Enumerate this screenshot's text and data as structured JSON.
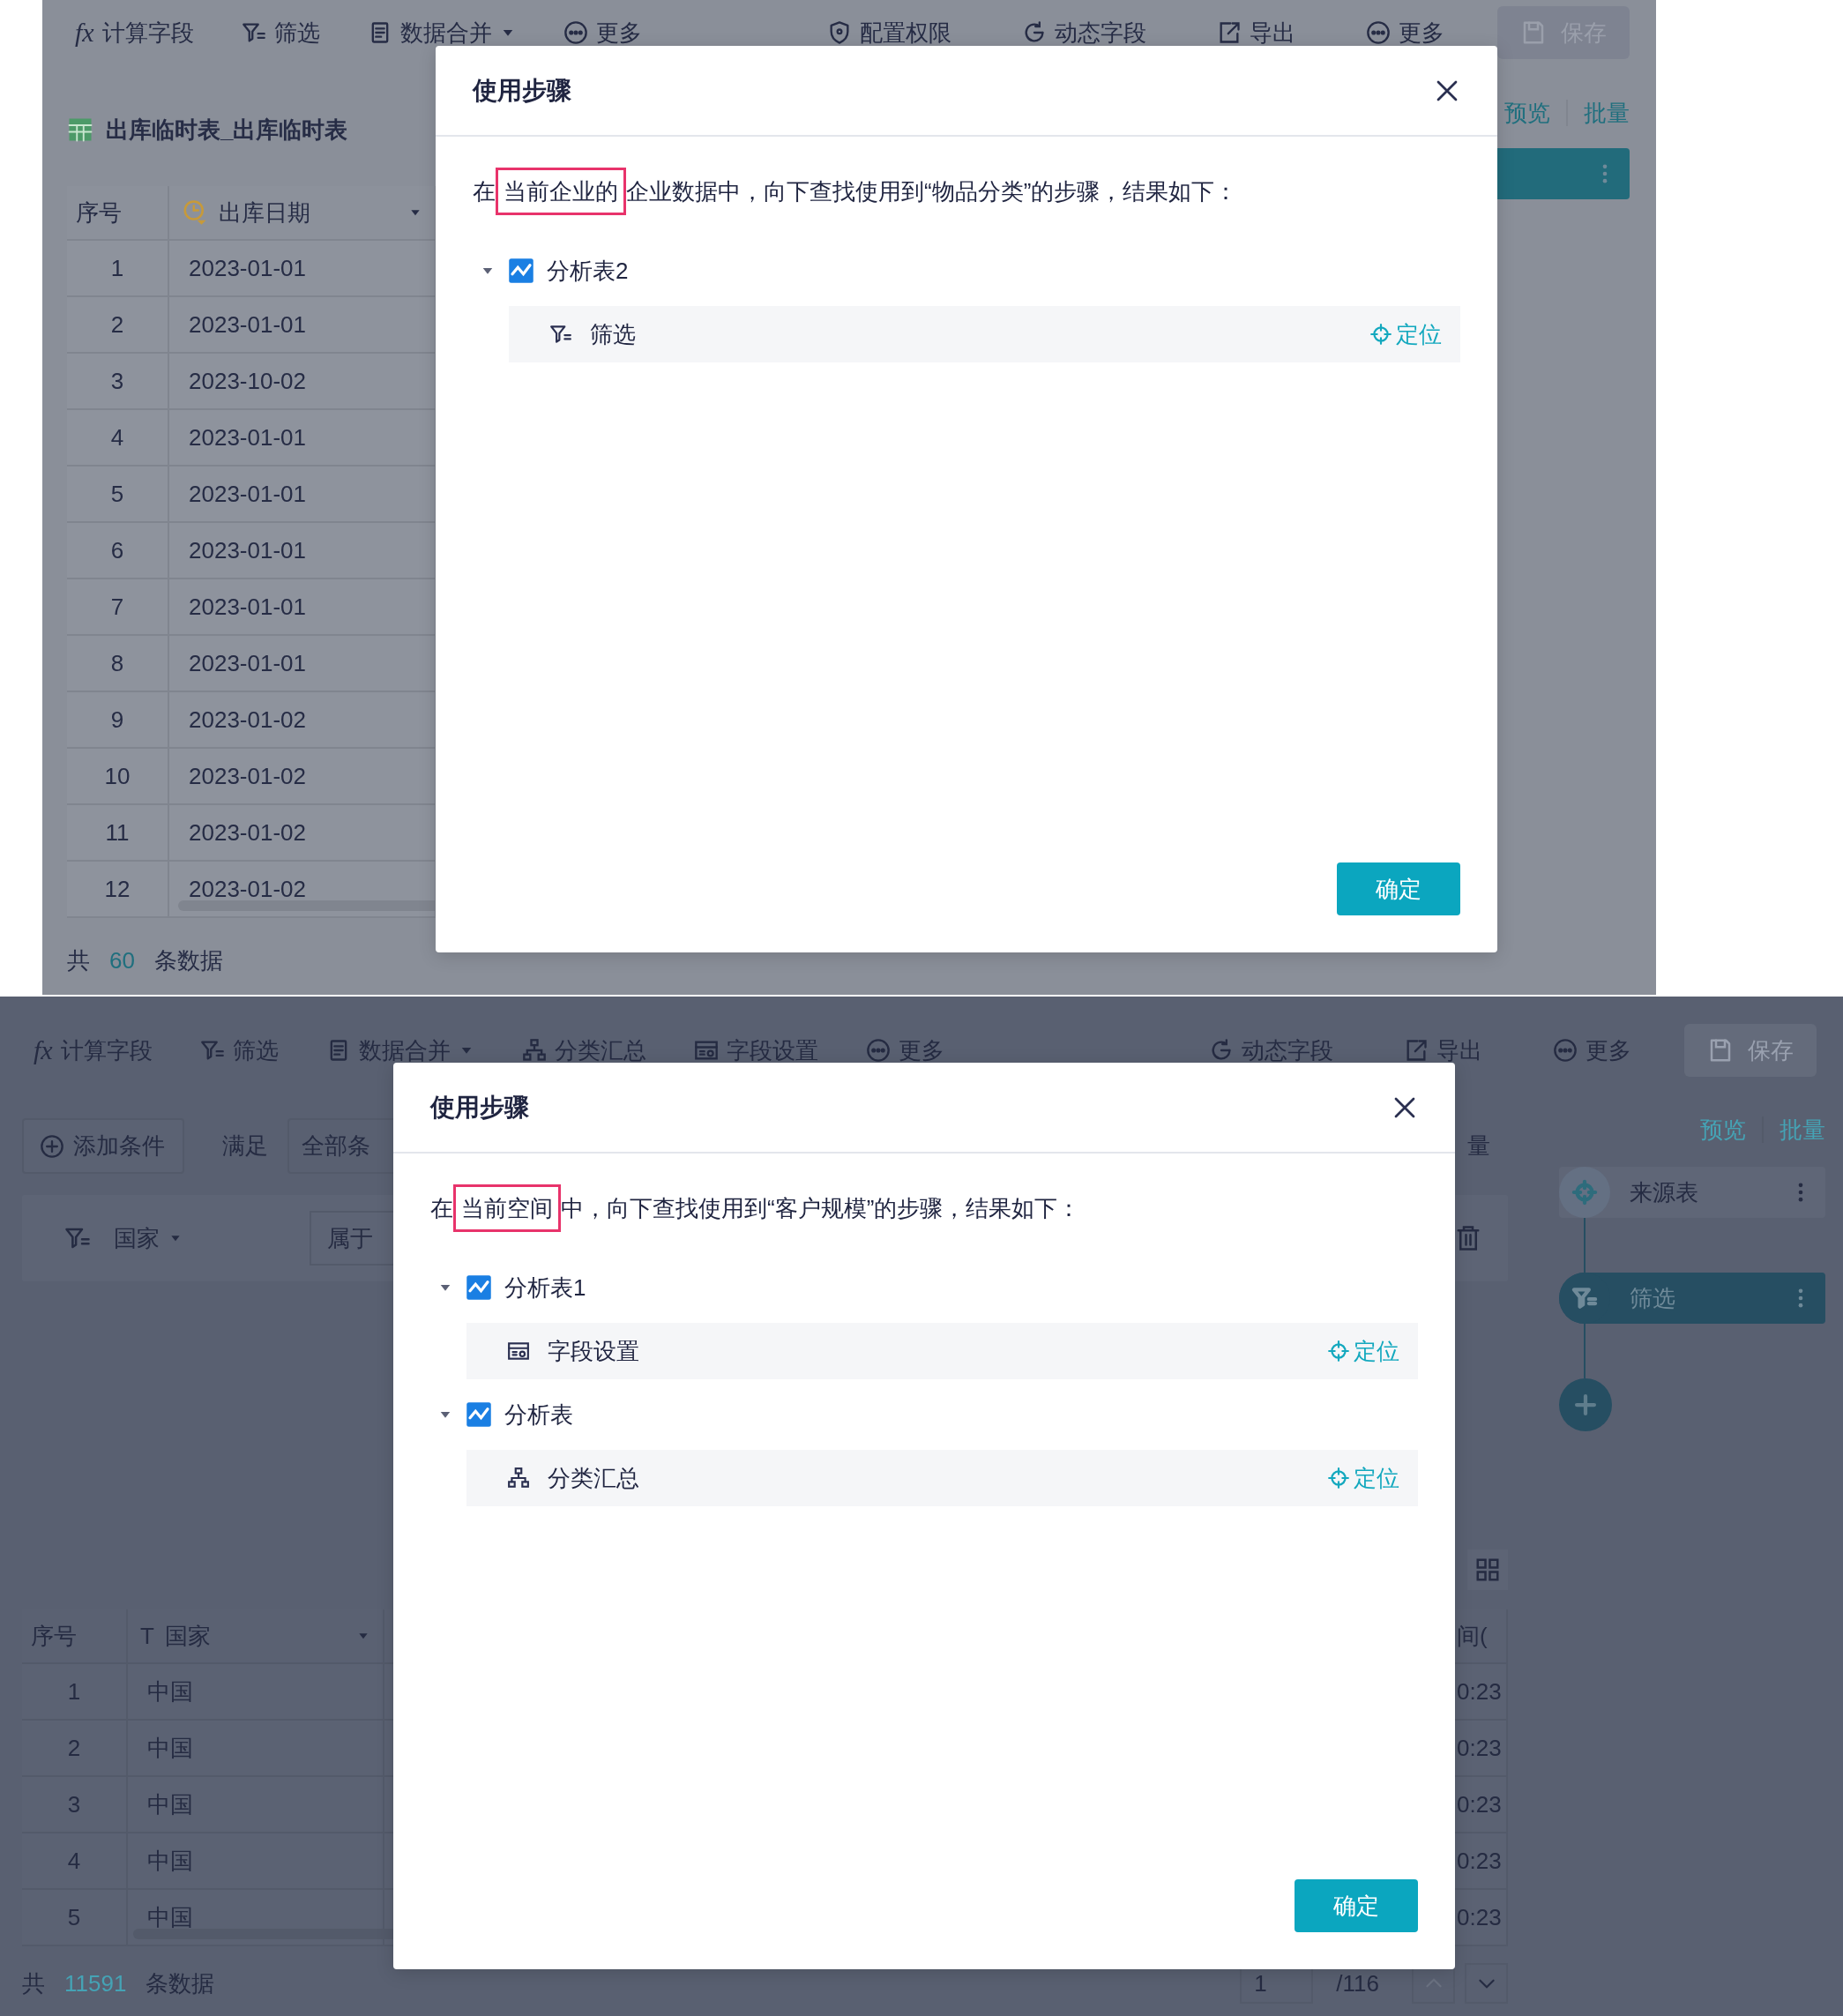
{
  "screens": [
    {
      "kind": "enterprise",
      "toolbar": {
        "left": [
          {
            "kind": "function",
            "glyph": "fx",
            "label": "计算字段",
            "dropdown": false
          },
          {
            "kind": "filter",
            "label": "筛选",
            "dropdown": false
          },
          {
            "kind": "document",
            "label": "数据合并",
            "dropdown": true
          },
          {
            "kind": "more",
            "label": "更多",
            "dropdown": false
          }
        ],
        "right": [
          {
            "kind": "shield",
            "label": "配置权限",
            "dropdown": false
          },
          {
            "kind": "refresh",
            "label": "动态字段",
            "dropdown": false
          },
          {
            "kind": "export",
            "label": "导出",
            "dropdown": false
          },
          {
            "kind": "more",
            "label": "更多",
            "dropdown": false
          }
        ],
        "save": {
          "label": "保存",
          "disabled": true
        }
      },
      "table_title": "出库临时表_出库临时表",
      "table": {
        "columns": [
          {
            "label": "序号",
            "dropdown": false
          },
          {
            "label": "出库日期",
            "kind": "date",
            "dropdown": true
          }
        ],
        "rows": [
          [
            "1",
            "2023-01-01"
          ],
          [
            "2",
            "2023-01-01"
          ],
          [
            "3",
            "2023-10-02"
          ],
          [
            "4",
            "2023-01-01"
          ],
          [
            "5",
            "2023-01-01"
          ],
          [
            "6",
            "2023-01-01"
          ],
          [
            "7",
            "2023-01-01"
          ],
          [
            "8",
            "2023-01-01"
          ],
          [
            "9",
            "2023-01-02"
          ],
          [
            "10",
            "2023-01-02"
          ],
          [
            "11",
            "2023-01-02"
          ],
          [
            "12",
            "2023-01-02"
          ]
        ]
      },
      "footer": {
        "prefix": "共",
        "count": "60",
        "suffix": "条数据"
      },
      "sidebar": {
        "links": [
          "预览",
          "批量"
        ],
        "nodes": [
          {
            "selected": true
          }
        ]
      },
      "modal": {
        "title": "使用步骤",
        "message": [
          {
            "text": "在",
            "highlighted": false
          },
          {
            "text": "当前企业的",
            "highlighted": true
          },
          {
            "text": "企业数据中，向下查找使用到“物品分类”的步骤，结果如下：",
            "highlighted": false
          }
        ],
        "results": [
          {
            "label": "分析表2",
            "expanded": true,
            "children": [
              {
                "kind": "filter",
                "label": "筛选",
                "action": "定位"
              }
            ]
          }
        ],
        "confirm": "确定"
      }
    },
    {
      "kind": "space",
      "toolbar": {
        "left": [
          {
            "kind": "function",
            "glyph": "fx",
            "label": "计算字段",
            "dropdown": false
          },
          {
            "kind": "filter",
            "label": "筛选",
            "dropdown": false
          },
          {
            "kind": "document",
            "label": "数据合并",
            "dropdown": true
          },
          {
            "kind": "hierarchy",
            "label": "分类汇总",
            "dropdown": false
          },
          {
            "kind": "form",
            "label": "字段设置",
            "dropdown": false
          },
          {
            "kind": "more",
            "label": "更多",
            "dropdown": false
          }
        ],
        "right": [
          {
            "kind": "refresh",
            "label": "动态字段",
            "dropdown": false
          },
          {
            "kind": "export",
            "label": "导出",
            "dropdown": false
          },
          {
            "kind": "more",
            "label": "更多",
            "dropdown": false
          }
        ],
        "save": {
          "label": "保存",
          "disabled": true
        }
      },
      "filter_bar": {
        "add_label": "添加条件",
        "match_label": "满足",
        "match_value": "全部条",
        "trailing": "量"
      },
      "condition": {
        "field": "国家",
        "operator": "属于"
      },
      "table": {
        "columns": [
          {
            "label": "序号",
            "dropdown": false
          },
          {
            "label": "国家",
            "kind": "text",
            "glyph": "T",
            "dropdown": true
          },
          {
            "label": "间(",
            "dropdown": false
          }
        ],
        "rows": [
          [
            "1",
            "中国",
            "0:23"
          ],
          [
            "2",
            "中国",
            "0:23"
          ],
          [
            "3",
            "中国",
            "0:23"
          ],
          [
            "4",
            "中国",
            "0:23"
          ],
          [
            "5",
            "中国",
            "0:23"
          ]
        ]
      },
      "footer": {
        "prefix": "共",
        "count": "11591",
        "suffix": "条数据"
      },
      "pagination": {
        "page": "1",
        "total": "/116",
        "buttons": [
          {
            "kind": "up",
            "disabled": true
          },
          {
            "kind": "down",
            "disabled": false
          }
        ]
      },
      "sidebar": {
        "links": [
          "预览",
          "批量"
        ],
        "nodes": [
          {
            "kind": "crosshair",
            "label": "来源表",
            "selected": false
          },
          {
            "kind": "filter",
            "label": "筛选",
            "selected": true
          }
        ],
        "add_button": true
      },
      "modal": {
        "title": "使用步骤",
        "message": [
          {
            "text": "在",
            "highlighted": false
          },
          {
            "text": "当前空间",
            "highlighted": true
          },
          {
            "text": "中，向下查找使用到“客户规模”的步骤，结果如下：",
            "highlighted": false
          }
        ],
        "results": [
          {
            "label": "分析表1",
            "expanded": true,
            "children": [
              {
                "kind": "form",
                "label": "字段设置",
                "action": "定位"
              }
            ]
          },
          {
            "label": "分析表",
            "expanded": true,
            "children": [
              {
                "kind": "hierarchy",
                "label": "分类汇总",
                "action": "定位"
              }
            ]
          }
        ],
        "confirm": "确定"
      }
    }
  ]
}
